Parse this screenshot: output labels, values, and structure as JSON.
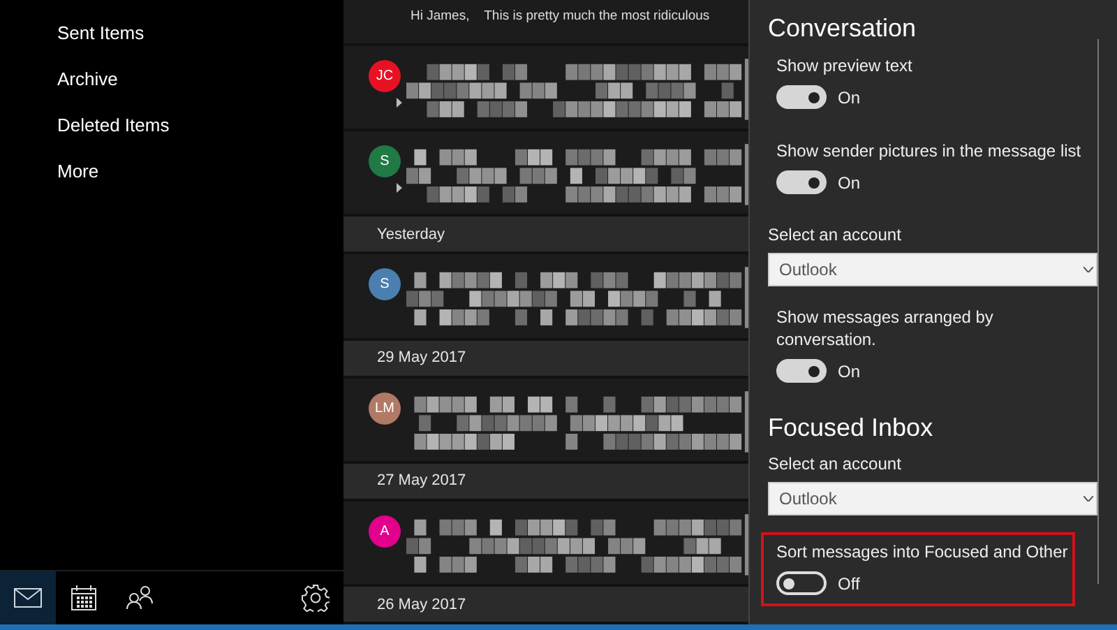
{
  "nav": {
    "folders": [
      {
        "label": "Sent Items"
      },
      {
        "label": "Archive"
      },
      {
        "label": "Deleted Items"
      },
      {
        "label": "More"
      }
    ],
    "bottom_bar": [
      {
        "kind": "mail",
        "selected": true
      },
      {
        "kind": "calendar",
        "selected": false
      },
      {
        "kind": "people",
        "selected": false
      },
      {
        "kind": "settings",
        "selected": false
      }
    ]
  },
  "message_list": {
    "top_preview": "Hi James,    This is pretty much the most ridiculous",
    "items": [
      {
        "kind": "message",
        "initials": "JC",
        "color": "#e81123",
        "thread": true
      },
      {
        "kind": "message",
        "initials": "S",
        "color": "#1f7a45",
        "thread": true
      },
      {
        "kind": "header",
        "label": "Yesterday"
      },
      {
        "kind": "message",
        "initials": "S",
        "color": "#4a7fb0",
        "thread": false
      },
      {
        "kind": "header",
        "label": "29 May 2017"
      },
      {
        "kind": "message",
        "initials": "LM",
        "color": "#b07a66",
        "thread": false
      },
      {
        "kind": "header",
        "label": "27 May 2017"
      },
      {
        "kind": "message",
        "initials": "A",
        "color": "#e3008c",
        "thread": false
      },
      {
        "kind": "header",
        "label": "26 May 2017"
      }
    ]
  },
  "settings": {
    "sections": [
      {
        "title": "Conversation",
        "items": [
          {
            "kind": "toggle",
            "label": "Show preview text",
            "on": true,
            "state_label": "On",
            "highlighted": false
          },
          {
            "kind": "toggle",
            "label": "Show sender pictures in the message list",
            "on": true,
            "state_label": "On",
            "highlighted": false
          },
          {
            "kind": "select",
            "label": "Select an account",
            "value": "Outlook"
          },
          {
            "kind": "toggle",
            "label": "Show messages arranged by conversation.",
            "on": true,
            "state_label": "On",
            "highlighted": false
          }
        ]
      },
      {
        "title": "Focused Inbox",
        "items": [
          {
            "kind": "select",
            "label": "Select an account",
            "value": "Outlook"
          },
          {
            "kind": "toggle",
            "label": "Sort messages into Focused and Other",
            "on": false,
            "state_label": "Off",
            "highlighted": true
          }
        ]
      }
    ]
  }
}
